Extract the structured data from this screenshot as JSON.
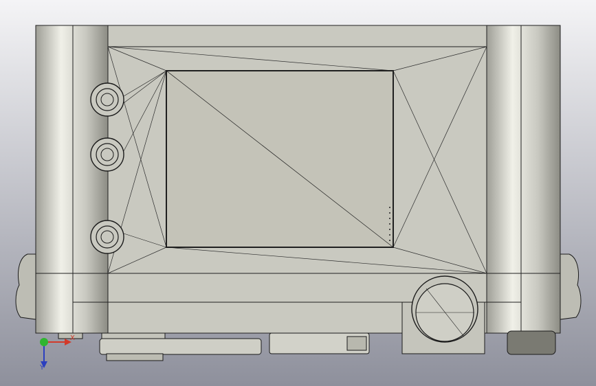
{
  "viewport": {
    "background_top": "#f4f4f6",
    "background_bottom": "#8e909c"
  },
  "model": {
    "body_fill": "#c9c9c0",
    "screen_fill": "#c4c3b8",
    "edge_color": "#1f1f1f",
    "highlight_color": "#f2f2ea"
  },
  "triad": {
    "x_label": "X",
    "y_label": "Y",
    "x_color": "#d23a2a",
    "y_color": "#2b3fbf",
    "origin_color": "#2fb52f"
  }
}
